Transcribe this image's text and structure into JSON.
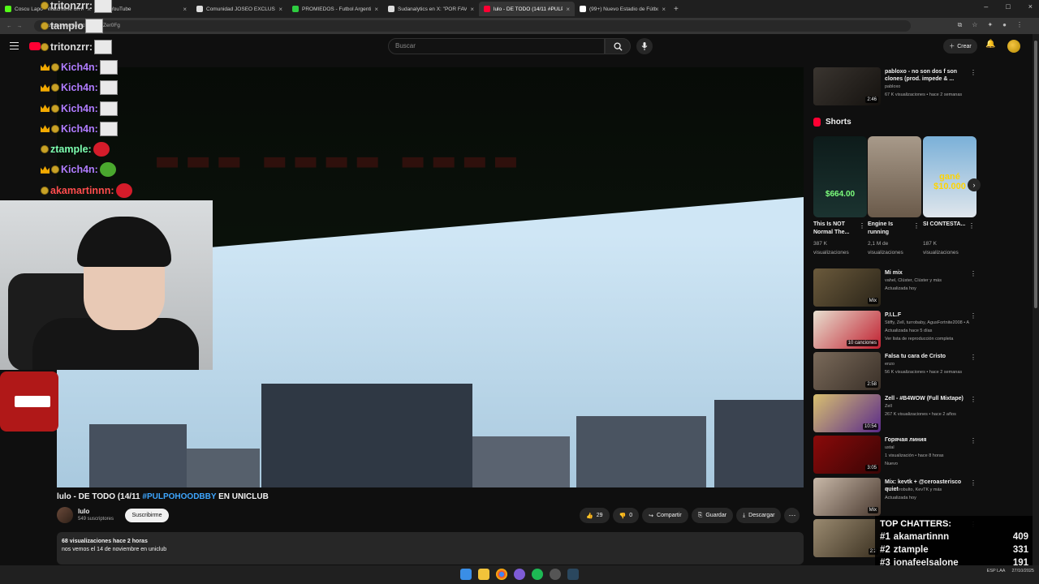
{
  "browser": {
    "tabs": [
      {
        "title": "Coscu Lapo - Watchtime on Kick",
        "color": "#53fc18",
        "active": false
      },
      {
        "title": "YouTube",
        "color": "#ff0033",
        "active": false
      },
      {
        "title": "Comunidad JOSEO EXCLUSIVE",
        "color": "#dddddd",
        "active": false
      },
      {
        "title": "PROMIEDOS - Futbol Argentino",
        "color": "#2ecc40",
        "active": false
      },
      {
        "title": "Sudanalytics en X: \"POR FAVOR",
        "color": "#dddddd",
        "active": false
      },
      {
        "title": "lulo - DE TODO (14/11 #PULPO",
        "color": "#ff0033",
        "active": true
      },
      {
        "title": "(99+) Nuevo Estadio de Fútbol",
        "color": "#ffffff",
        "active": false
      }
    ],
    "url": "youtube.com/watch?v=lydZer0Fg"
  },
  "youtube": {
    "search_placeholder": "Buscar",
    "create_label": "Crear",
    "logo_text": "YouTube"
  },
  "video": {
    "title_prefix": "lulo - DE TODO (14/11 ",
    "title_tag": "#PULPOHOODBBY",
    "title_suffix": " EN UNICLUB",
    "channel": "lulo",
    "subscribers": "549 suscriptores",
    "subscribe_label": "Suscribirme",
    "likes": "29",
    "dislikes": "0",
    "share_label": "Compartir",
    "save_label": "Guardar",
    "download_label": "Descargar",
    "views_line": "68 visualizaciones  hace 2 horas",
    "description": "nos vemos el 14 de noviembre en uniclub"
  },
  "chat": [
    {
      "user": "tritonzrr:",
      "color": "#d9d9d9",
      "crown": false,
      "emote": "box"
    },
    {
      "user": "tamplo",
      "color": "#d9d9d9",
      "crown": false,
      "emote": "box"
    },
    {
      "user": "tritonzrr:",
      "color": "#d9d9d9",
      "crown": false,
      "emote": "box"
    },
    {
      "user": "Kich4n:",
      "color": "#b07cff",
      "crown": true,
      "emote": "box"
    },
    {
      "user": "Kich4n:",
      "color": "#b07cff",
      "crown": true,
      "emote": "box"
    },
    {
      "user": "Kich4n:",
      "color": "#b07cff",
      "crown": true,
      "emote": "box"
    },
    {
      "user": "Kich4n:",
      "color": "#b07cff",
      "crown": true,
      "emote": "box"
    },
    {
      "user": "ztample:",
      "color": "#7dffb0",
      "crown": false,
      "emote": "red"
    },
    {
      "user": "Kich4n:",
      "color": "#b07cff",
      "crown": true,
      "emote": "green"
    },
    {
      "user": "akamartinnn:",
      "color": "#ff4d4d",
      "crown": false,
      "emote": "red"
    }
  ],
  "sidebar": {
    "first": {
      "title": "pabloxo - no son dos f son clones (prod. impede & ...",
      "channel": "pabloxo",
      "meta": "67 K visualizaciones • hace 2 semanas",
      "duration": "2:46"
    },
    "shorts_label": "Shorts",
    "shorts": [
      {
        "title": "This Is NOT Normal The...",
        "views": "387 K visualizaciones",
        "overlay": "$664.00"
      },
      {
        "title": "Engine Is running",
        "views": "2,1 M de visualizaciones",
        "overlay": ""
      },
      {
        "title": "SI CONTESTA...",
        "views": "187 K visualizaciones",
        "overlay": "gané $10.000"
      }
    ],
    "items": [
      {
        "title": "Mi mix",
        "meta1": "vahel, Clúster, Clúster y más",
        "meta2": "Actualizada hoy",
        "meta3": "",
        "duration": "Mix",
        "c1": "#6b5a3c",
        "c2": "#2a2418"
      },
      {
        "title": "P.I.L.F",
        "meta1": "Stiffy, Zell, turrobaby, AgusFortnite2008 • A",
        "meta2": "Actualizada hace 5 días",
        "meta3": "Ver lista de reproducción completa",
        "duration": "10 canciones",
        "c1": "#e8e0d0",
        "c2": "#c02030"
      },
      {
        "title": "Falsa tu cara de Cristo",
        "meta1": "enzo",
        "meta2": "56 K visualizaciones • hace 2 semanas",
        "meta3": "",
        "duration": "2:58",
        "c1": "#7a6a5a",
        "c2": "#3a3028"
      },
      {
        "title": "Zell - #B4WOW (Full Mixtape)",
        "meta1": "Zell",
        "meta2": "267 K visualizaciones • hace 2 años",
        "meta3": "",
        "duration": "10:54",
        "c1": "#d8c070",
        "c2": "#5a2a8a"
      },
      {
        "title": "Горячая линия",
        "meta1": "ustal",
        "meta2": "1 visualización • hace 8 horas",
        "meta3": "Nuevo",
        "duration": "3:05",
        "c1": "#8a0a0a",
        "c2": "#3a0505"
      },
      {
        "title": "Mix: kevtk + @ceroasterisco quiet",
        "meta1": "enzocerobulto, KevTK y más",
        "meta2": "Actualizada hoy",
        "meta3": "",
        "duration": "Mix",
        "c1": "#c8b8a8",
        "c2": "#4a3a30"
      },
      {
        "title": "",
        "meta1": "",
        "meta2": "hace 2 semanas",
        "meta3": "",
        "duration": "2:2",
        "c1": "#9a8a70",
        "c2": "#3a3020"
      }
    ]
  },
  "top_chatters": {
    "title": "TOP CHATTERS:",
    "rows": [
      {
        "rank": "#1",
        "name": "akamartinnn",
        "count": "409"
      },
      {
        "rank": "#2",
        "name": "ztample",
        "count": "331"
      },
      {
        "rank": "#3",
        "name": "jonafeelsalone",
        "count": "191"
      }
    ]
  },
  "taskbar": {
    "lang": "ESP LAA",
    "date": "27/10/2025"
  }
}
